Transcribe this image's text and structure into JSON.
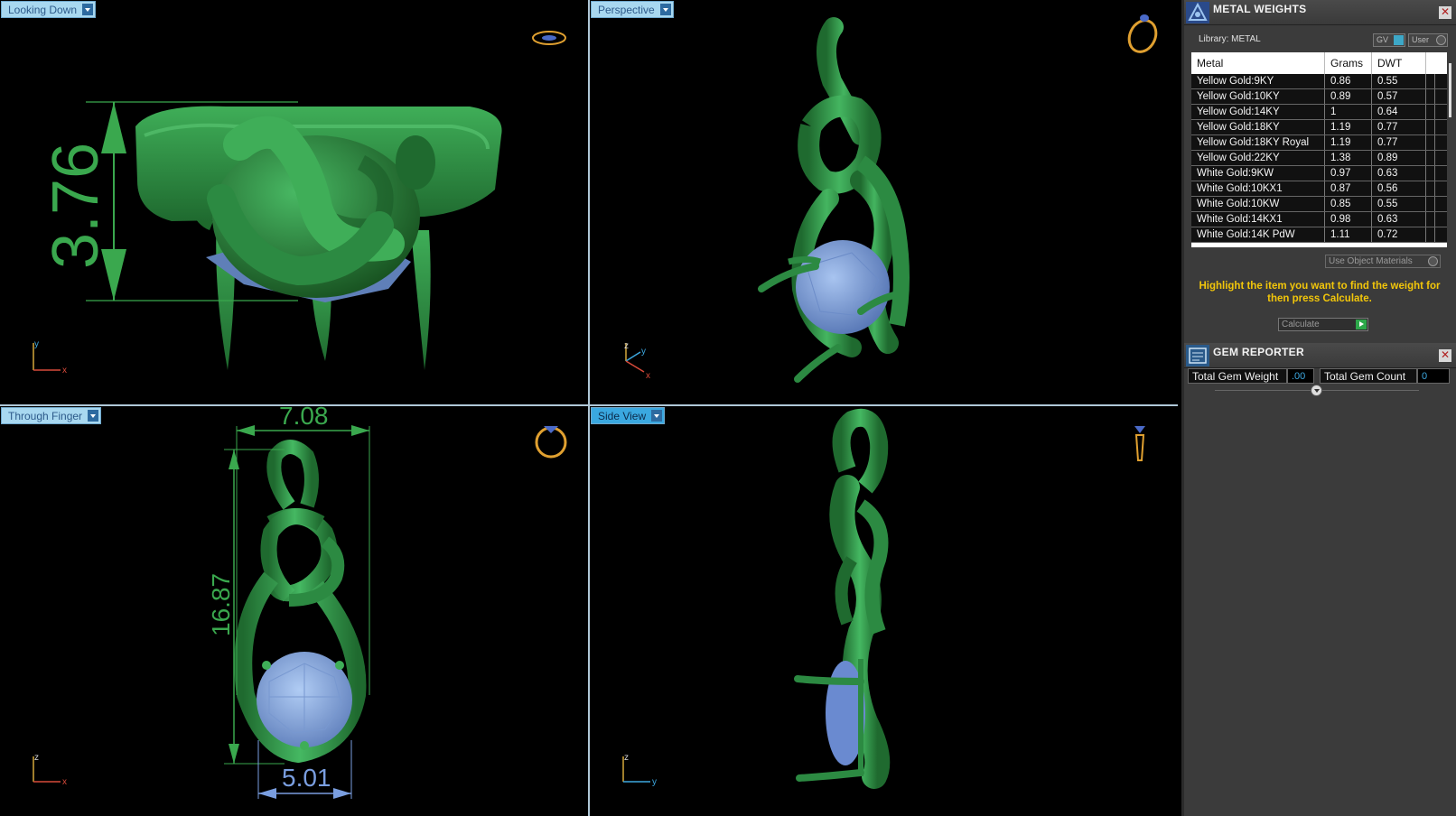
{
  "viewports": {
    "top_left": {
      "label": "Looking Down",
      "dimension": "3.76",
      "axis_x": "x",
      "axis_y": "y"
    },
    "top_right": {
      "label": "Perspective",
      "axis_x": "x",
      "axis_y": "y",
      "axis_z": "z"
    },
    "bottom_left": {
      "label": "Through Finger",
      "dim_width": "7.08",
      "dim_height": "16.87",
      "dim_gem": "5.01",
      "axis_x": "x",
      "axis_z": "z"
    },
    "bottom_right": {
      "label": "Side View",
      "axis_y": "y",
      "axis_z": "z"
    }
  },
  "metal_weights": {
    "title": "METAL WEIGHTS",
    "library_label": "Library: METAL",
    "gv_button": "GV",
    "user_button": "User",
    "columns": [
      "Metal",
      "Grams",
      "DWT"
    ],
    "rows": [
      {
        "metal": "Yellow Gold:9KY",
        "grams": "0.86",
        "dwt": "0.55"
      },
      {
        "metal": "Yellow Gold:10KY",
        "grams": "0.89",
        "dwt": "0.57"
      },
      {
        "metal": "Yellow Gold:14KY",
        "grams": "1",
        "dwt": "0.64"
      },
      {
        "metal": "Yellow Gold:18KY",
        "grams": "1.19",
        "dwt": "0.77"
      },
      {
        "metal": "Yellow Gold:18KY Royal",
        "grams": "1.19",
        "dwt": "0.77"
      },
      {
        "metal": "Yellow Gold:22KY",
        "grams": "1.38",
        "dwt": "0.89"
      },
      {
        "metal": "White Gold:9KW",
        "grams": "0.97",
        "dwt": "0.63"
      },
      {
        "metal": "White Gold:10KX1",
        "grams": "0.87",
        "dwt": "0.56"
      },
      {
        "metal": "White Gold:10KW",
        "grams": "0.85",
        "dwt": "0.55"
      },
      {
        "metal": "White Gold:14KX1",
        "grams": "0.98",
        "dwt": "0.63"
      },
      {
        "metal": "White Gold:14K PdW",
        "grams": "1.11",
        "dwt": "0.72"
      }
    ],
    "use_object_materials": "Use Object Materials",
    "hint": "Highlight the item you want to find the weight for then press Calculate.",
    "calculate_button": "Calculate"
  },
  "gem_reporter": {
    "title": "GEM REPORTER",
    "total_gem_weight_label": "Total Gem Weight",
    "total_gem_weight_value": ".00",
    "total_gem_count_label": "Total Gem Count",
    "total_gem_count_value": "0"
  },
  "colors": {
    "model_green": "#2e8f45",
    "gem_blue": "#7a9ee0",
    "dimension_green": "#3aa84e",
    "hint_yellow": "#f2c60a",
    "label_bg": "#a8d8f0"
  }
}
